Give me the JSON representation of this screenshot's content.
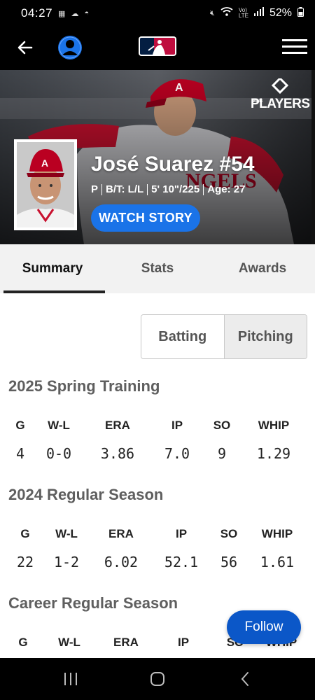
{
  "status_bar": {
    "time": "04:27",
    "left_icons": [
      "notification-icon",
      "cloud-icon",
      "incognito-icon"
    ],
    "right_icons": [
      "mute-icon",
      "wifi-icon",
      "volte-icon",
      "signal-icon"
    ],
    "battery": "52%"
  },
  "header": {
    "back_icon": "arrow-left-icon",
    "profile_icon": "user-circle-icon",
    "logo": "mlb-logo",
    "menu_icon": "hamburger-menu-icon"
  },
  "hero": {
    "badge_top": "MLB",
    "badge_main": "PLAYERS",
    "player_name": "José Suarez #54",
    "position": "P",
    "bats_throws": "B/T: L/L",
    "height_weight": "5' 10\"/225",
    "age": "Age: 27",
    "watch_label": "WATCH STORY"
  },
  "tabs": [
    {
      "label": "Summary",
      "active": true
    },
    {
      "label": "Stats",
      "active": false
    },
    {
      "label": "Awards",
      "active": false
    }
  ],
  "segmented": {
    "batting": "Batting",
    "pitching": "Pitching",
    "selected": "Pitching"
  },
  "stat_headers": [
    "G",
    "W-L",
    "ERA",
    "IP",
    "SO",
    "WHIP"
  ],
  "sections": [
    {
      "title": "2025 Spring Training",
      "values": [
        "4",
        "0-0",
        "3.86",
        "7.0",
        "9",
        "1.29"
      ]
    },
    {
      "title": "2024 Regular Season",
      "values": [
        "22",
        "1-2",
        "6.02",
        "52.1",
        "56",
        "1.61"
      ]
    },
    {
      "title": "Career Regular Season",
      "values": []
    }
  ],
  "follow_label": "Follow",
  "nav_bar": {
    "recents_icon": "recents-icon",
    "home_icon": "home-icon",
    "back_icon": "nav-back-icon"
  },
  "colors": {
    "accent_blue": "#1a73e8",
    "follow_blue": "#0b57c8",
    "angels_red": "#ba0021"
  }
}
